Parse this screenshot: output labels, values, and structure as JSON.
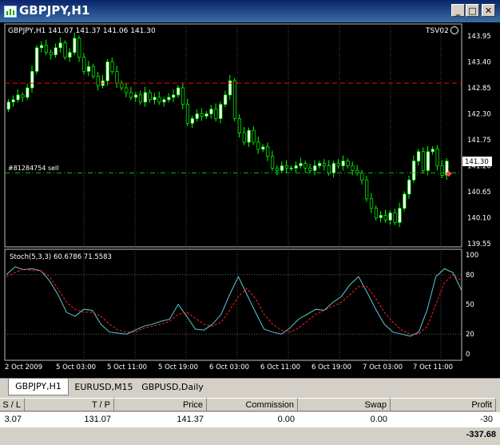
{
  "window": {
    "title": "GBPJPY,H1"
  },
  "chart": {
    "info": "GBPJPY,H1  141.07 141.37 141.06 141.30",
    "indicator_name": "TSV02",
    "price_labels": [
      "143.95",
      "143.40",
      "142.85",
      "142.30",
      "141.75",
      "141.20",
      "140.65",
      "140.10",
      "139.55"
    ],
    "current_price": "141.30",
    "order_label": "#81284754 sell",
    "stoch_info": "Stoch(5,3,3) 60.6786 71.5583",
    "stoch_labels": [
      "100",
      "80",
      "50",
      "20",
      "0"
    ],
    "time_labels": [
      "2 Oct 2009",
      "5 Oct 03:00",
      "5 Oct 11:00",
      "5 Oct 19:00",
      "6 Oct 03:00",
      "6 Oct 11:00",
      "6 Oct 19:00",
      "7 Oct 03:00",
      "7 Oct 11:00"
    ],
    "colors": {
      "bull": "#ffffff",
      "bear": "#00ff00",
      "main_line": "#5ec8d8",
      "signal_line": "#ff2020",
      "red_level": "#ff0000",
      "order_level": "#00c000"
    },
    "levels": {
      "red_price": 142.95,
      "order_price": 141.05
    }
  },
  "tabs": [
    {
      "label": "GBPJPY,H1",
      "active": true
    },
    {
      "label": "EURUSD,M15",
      "active": false
    },
    {
      "label": "GBPUSD,Daily",
      "active": false
    }
  ],
  "orders": {
    "headers": [
      "S / L",
      "T / P",
      "Price",
      "Commission",
      "Swap",
      "Profit"
    ],
    "row": [
      "3.07",
      "131.07",
      "141.37",
      "0.00",
      "0.00",
      "-30"
    ],
    "total": "-337.68"
  }
}
